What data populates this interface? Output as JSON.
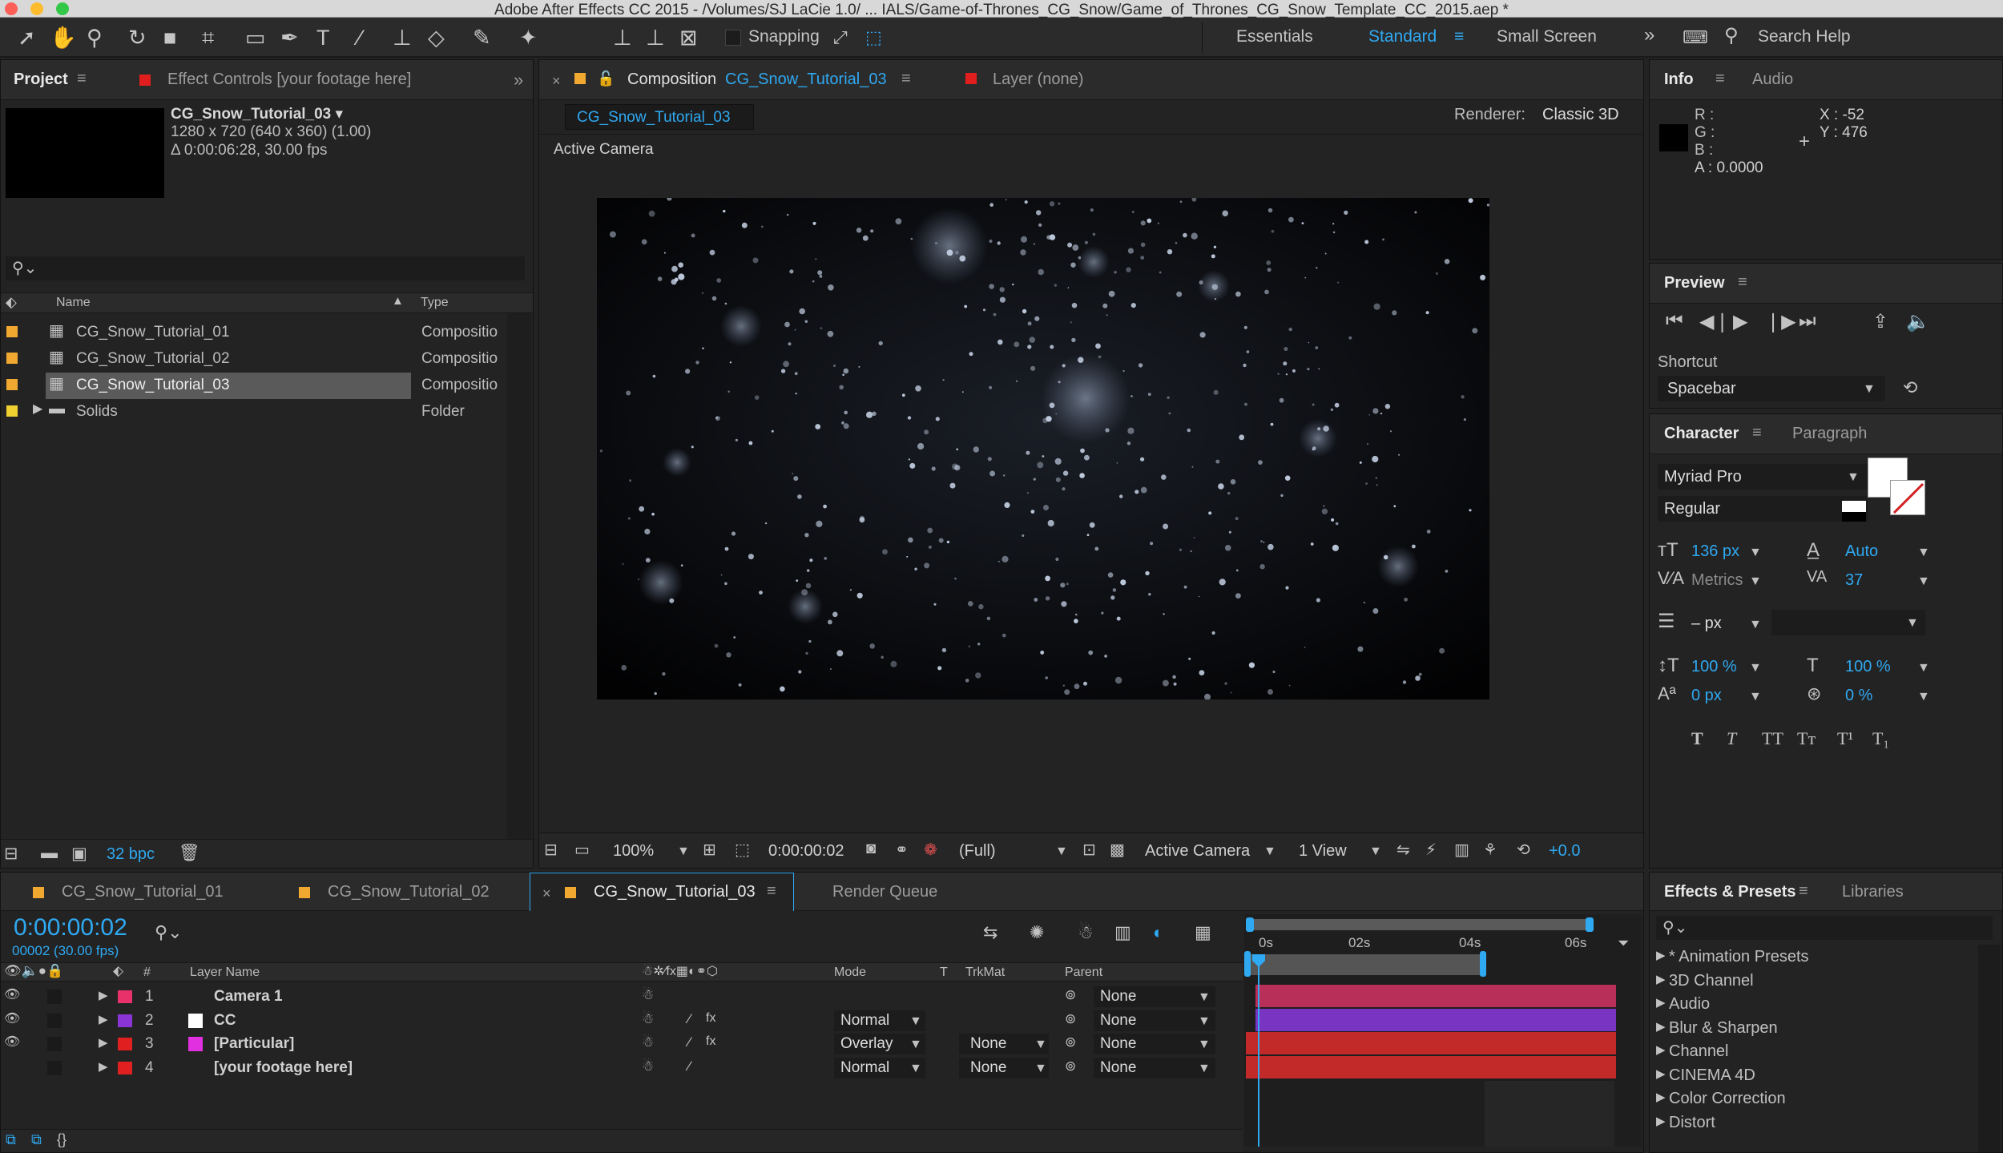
{
  "window": {
    "title": "Adobe After Effects CC 2015 - /Volumes/SJ LaCie 1.0/ ... IALS/Game-of-Thrones_CG_Snow/Game_of_Thrones_CG_Snow_Template_CC_2015.aep *"
  },
  "toolbar": {
    "snapping": "Snapping",
    "workspaces": [
      "Essentials",
      "Standard",
      "Small Screen"
    ],
    "search_placeholder": "Search Help"
  },
  "project": {
    "tab": "Project",
    "effect_controls_tab": "Effect Controls [your footage here]",
    "item_name": "CG_Snow_Tutorial_03 ▾",
    "item_size": "1280 x 720  (640 x 360) (1.00)",
    "item_duration": "Δ 0:00:06:28, 30.00 fps",
    "col_name": "Name",
    "col_type": "Type",
    "items": [
      {
        "name": "CG_Snow_Tutorial_01",
        "type": "Compositio"
      },
      {
        "name": "CG_Snow_Tutorial_02",
        "type": "Compositio"
      },
      {
        "name": "CG_Snow_Tutorial_03",
        "type": "Compositio"
      },
      {
        "name": "Solids",
        "type": "Folder"
      }
    ],
    "bpc": "32 bpc"
  },
  "composition": {
    "tab_prefix": "Composition",
    "tab_name": "CG_Snow_Tutorial_03",
    "layer_tab": "Layer (none)",
    "subtab": "CG_Snow_Tutorial_03",
    "renderer_label": "Renderer:",
    "renderer_value": "Classic 3D",
    "camera_label": "Active Camera",
    "zoom": "100%",
    "timecode": "0:00:00:02",
    "resolution": "(Full)",
    "view_camera": "Active Camera",
    "views": "1 View",
    "exposure": "+0.0"
  },
  "info": {
    "tab": "Info",
    "audio_tab": "Audio",
    "r": "R :",
    "g": "G :",
    "b": "B :",
    "a": "A : 0.0000",
    "x": "X : -52",
    "y": "Y : 476"
  },
  "preview": {
    "tab": "Preview",
    "shortcut_label": "Shortcut",
    "shortcut_value": "Spacebar"
  },
  "character": {
    "tab": "Character",
    "paragraph_tab": "Paragraph",
    "font": "Myriad Pro",
    "style": "Regular",
    "size": "136 px",
    "leading": "Auto",
    "kerning": "Metrics",
    "tracking": "37",
    "stroke": "– px",
    "vscale": "100 %",
    "hscale": "100 %",
    "baseline": "0 px",
    "tsume": "0 %",
    "styles": [
      "T",
      "T",
      "TT",
      "Tт",
      "T¹",
      "T₁"
    ]
  },
  "timeline": {
    "tabs": [
      "CG_Snow_Tutorial_01",
      "CG_Snow_Tutorial_02",
      "CG_Snow_Tutorial_03",
      "Render Queue"
    ],
    "timecode": "0:00:00:02",
    "frames": "00002 (30.00 fps)",
    "col_num": "#",
    "col_layer": "Layer Name",
    "col_mode": "Mode",
    "col_t": "T",
    "col_trkmat": "TrkMat",
    "col_parent": "Parent",
    "ruler": [
      "0s",
      "02s",
      "04s",
      "06s"
    ],
    "layers": [
      {
        "num": "1",
        "name": "Camera 1",
        "color": "#e8306a",
        "mode": "",
        "trkmat": "",
        "parent": "None"
      },
      {
        "num": "2",
        "name": "CC",
        "color": "#8a34d6",
        "mode": "Normal",
        "trkmat": "",
        "parent": "None"
      },
      {
        "num": "3",
        "name": "[Particular]",
        "color": "#e02020",
        "mode": "Overlay",
        "trkmat": "None",
        "parent": "None"
      },
      {
        "num": "4",
        "name": "[your footage here]",
        "color": "#e02020",
        "mode": "Normal",
        "trkmat": "None",
        "parent": "None"
      }
    ]
  },
  "effects": {
    "tab": "Effects & Presets",
    "libraries_tab": "Libraries",
    "items": [
      "* Animation Presets",
      "3D Channel",
      "Audio",
      "Blur & Sharpen",
      "Channel",
      "CINEMA 4D",
      "Color Correction",
      "Distort"
    ]
  }
}
